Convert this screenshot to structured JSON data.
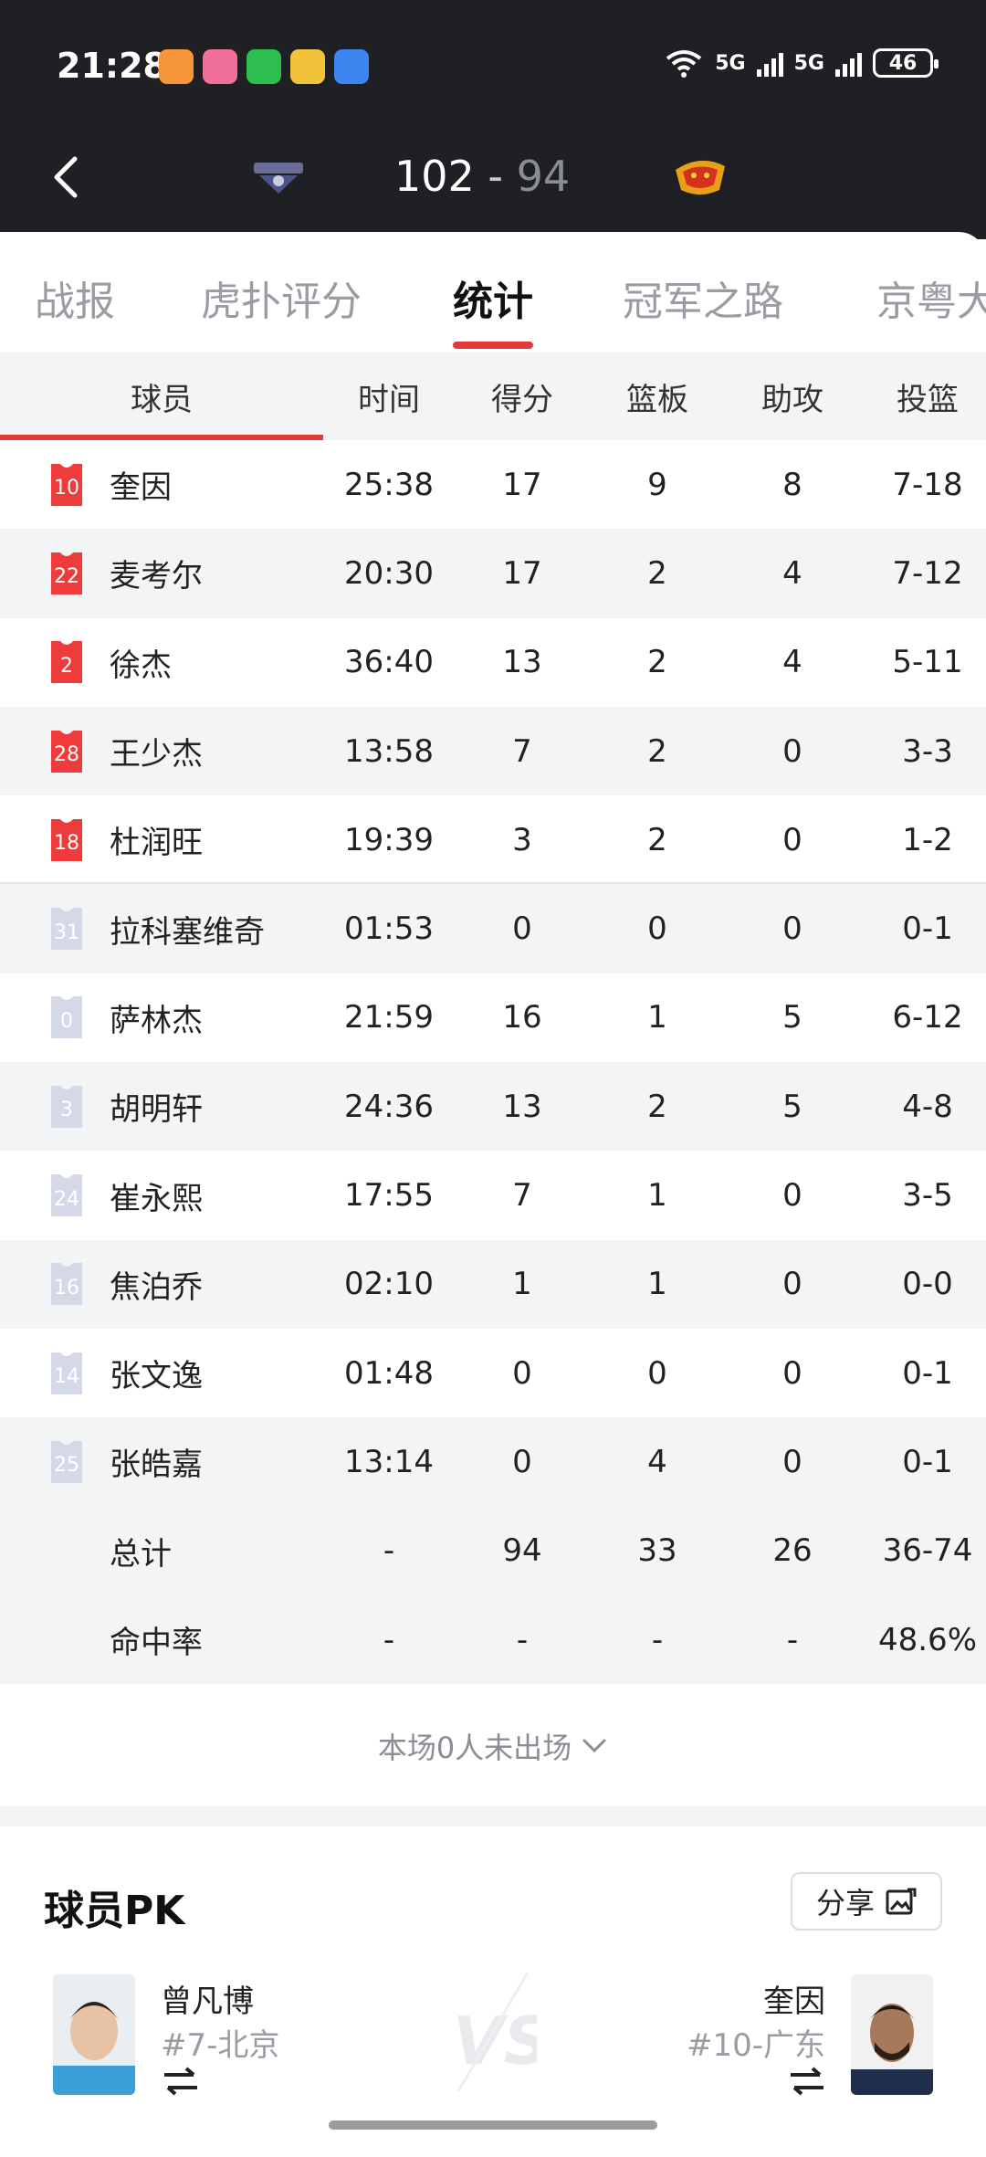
{
  "status_bar": {
    "time": "21:28",
    "network_1": "5G",
    "network_2": "5G",
    "battery": "46",
    "wifi_label": "6",
    "notification_icons": [
      "heart-app-icon",
      "bilibili-icon",
      "wechat-icon",
      "weibo-icon",
      "message-icon"
    ]
  },
  "header": {
    "home_score": "102",
    "separator": " - ",
    "away_score": "94",
    "home_team_logo": "ducks-logo",
    "away_team_logo": "southern-tigers-logo"
  },
  "tabs": [
    {
      "label": "战报",
      "active": false
    },
    {
      "label": "虎扑评分",
      "active": false
    },
    {
      "label": "统计",
      "active": true
    },
    {
      "label": "冠军之路",
      "active": false
    },
    {
      "label": "京粤大",
      "active": false
    }
  ],
  "table": {
    "headers": [
      "球员",
      "时间",
      "得分",
      "篮板",
      "助攻",
      "投篮"
    ],
    "rows": [
      {
        "number": "10",
        "name": "奎因",
        "time": "25:38",
        "pts": "17",
        "reb": "9",
        "ast": "8",
        "fg": "7-18",
        "starter": true
      },
      {
        "number": "22",
        "name": "麦考尔",
        "time": "20:30",
        "pts": "17",
        "reb": "2",
        "ast": "4",
        "fg": "7-12",
        "starter": true
      },
      {
        "number": "2",
        "name": "徐杰",
        "time": "36:40",
        "pts": "13",
        "reb": "2",
        "ast": "4",
        "fg": "5-11",
        "starter": true
      },
      {
        "number": "28",
        "name": "王少杰",
        "time": "13:58",
        "pts": "7",
        "reb": "2",
        "ast": "0",
        "fg": "3-3",
        "starter": true
      },
      {
        "number": "18",
        "name": "杜润旺",
        "time": "19:39",
        "pts": "3",
        "reb": "2",
        "ast": "0",
        "fg": "1-2",
        "starter": true
      },
      {
        "number": "31",
        "name": "拉科塞维奇",
        "time": "01:53",
        "pts": "0",
        "reb": "0",
        "ast": "0",
        "fg": "0-1",
        "starter": false
      },
      {
        "number": "0",
        "name": "萨林杰",
        "time": "21:59",
        "pts": "16",
        "reb": "1",
        "ast": "5",
        "fg": "6-12",
        "starter": false
      },
      {
        "number": "3",
        "name": "胡明轩",
        "time": "24:36",
        "pts": "13",
        "reb": "2",
        "ast": "5",
        "fg": "4-8",
        "starter": false
      },
      {
        "number": "24",
        "name": "崔永熙",
        "time": "17:55",
        "pts": "7",
        "reb": "1",
        "ast": "0",
        "fg": "3-5",
        "starter": false
      },
      {
        "number": "16",
        "name": "焦泊乔",
        "time": "02:10",
        "pts": "1",
        "reb": "1",
        "ast": "0",
        "fg": "0-0",
        "starter": false
      },
      {
        "number": "14",
        "name": "张文逸",
        "time": "01:48",
        "pts": "0",
        "reb": "0",
        "ast": "0",
        "fg": "0-1",
        "starter": false
      },
      {
        "number": "25",
        "name": "张皓嘉",
        "time": "13:14",
        "pts": "0",
        "reb": "4",
        "ast": "0",
        "fg": "0-1",
        "starter": false
      }
    ],
    "totals": {
      "label": "总计",
      "time": "-",
      "pts": "94",
      "reb": "33",
      "ast": "26",
      "fg": "36-74"
    },
    "percent": {
      "label": "命中率",
      "time": "-",
      "pts": "-",
      "reb": "-",
      "ast": "-",
      "fg": "48.6%"
    }
  },
  "dnp": {
    "label": "本场0人未出场"
  },
  "pk": {
    "title": "球员PK",
    "share_label": "分享",
    "left": {
      "name": "曾凡博",
      "sub": "#7-北京"
    },
    "right": {
      "name": "奎因",
      "sub": "#10-广东"
    },
    "vs_label": "VS"
  },
  "colors": {
    "accent": "#e33a3a",
    "header_bg": "#1f2024",
    "starter_jersey": "#ee3b3b",
    "bench_jersey": "#d5d8e6"
  }
}
